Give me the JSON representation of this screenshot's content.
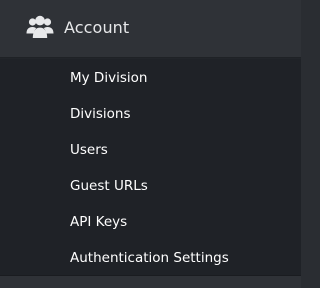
{
  "sidebar": {
    "section": {
      "label": "Account",
      "icon": "users-group-icon"
    },
    "items": [
      {
        "label": "My Division"
      },
      {
        "label": "Divisions"
      },
      {
        "label": "Users"
      },
      {
        "label": "Guest URLs"
      },
      {
        "label": "API Keys"
      },
      {
        "label": "Authentication Settings"
      }
    ]
  },
  "colors": {
    "header_bg": "#2f3237",
    "submenu_bg": "#1f2227",
    "text": "#ffffff",
    "icon": "#e7e8ea"
  }
}
